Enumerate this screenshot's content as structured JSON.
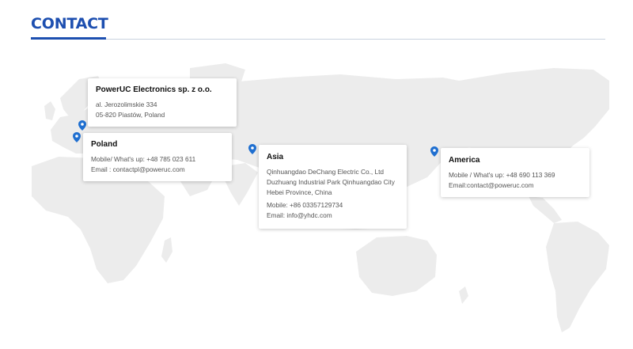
{
  "page": {
    "title": "CONTACT"
  },
  "colors": {
    "accent": "#1d4fb0",
    "pin": "#1f6fd0",
    "map": "#ececec"
  },
  "offices": {
    "hq": {
      "name": "PowerUC Electronics sp. z o.o.",
      "address_line1": "al. Jerozolimskie 334",
      "address_line2": "05-820 Piastów, Poland"
    },
    "poland": {
      "name": "Poland",
      "mobile": "Mobile/ What's up: +48 785 023 611",
      "email": "Email : contactpl@poweruc.com"
    },
    "asia": {
      "name": "Asia",
      "company": "Qinhuangdao DeChang Electric Co., Ltd",
      "address_line1": "Duzhuang Industrial Park Qinhuangdao City",
      "address_line2": "Hebei Province, China",
      "mobile": "Mobile: +86 03357129734",
      "email": "Email: info@yhdc.com"
    },
    "america": {
      "name": "America",
      "mobile": "Mobile / What's up: +48 690 113 369",
      "email": "Email:contact@poweruc.com"
    }
  },
  "icons": {
    "pin": "map-pin-icon"
  }
}
